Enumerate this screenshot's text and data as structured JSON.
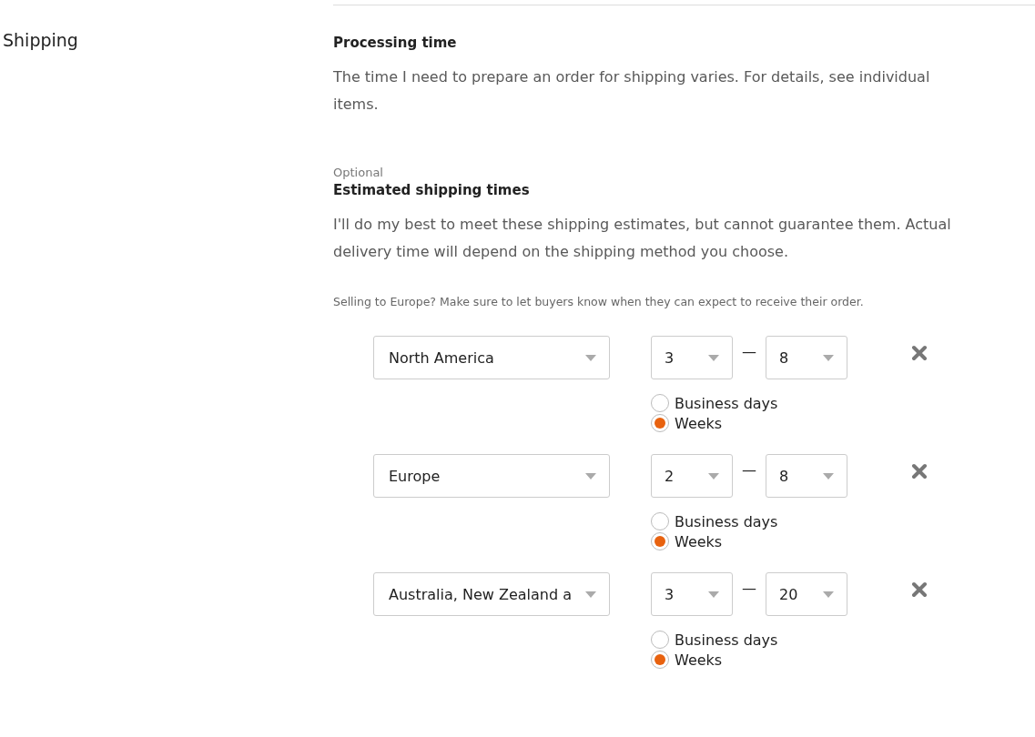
{
  "section_title": "Shipping",
  "processing": {
    "title": "Processing time",
    "text": "The time I need to prepare an order for shipping varies. For details, see individual items."
  },
  "estimates": {
    "optional_label": "Optional",
    "title": "Estimated shipping times",
    "text": "I'll do my best to meet these shipping estimates, but cannot guarantee them. Actual delivery time will depend on the shipping method you choose.",
    "note": "Selling to Europe? Make sure to let buyers know when they can expect to receive their order."
  },
  "rows": [
    {
      "region": "North America",
      "min": "3",
      "separator": "—",
      "max": "8",
      "units": [
        {
          "label": "Business days",
          "selected": false
        },
        {
          "label": "Weeks",
          "selected": true
        }
      ]
    },
    {
      "region": "Europe",
      "min": "2",
      "separator": "—",
      "max": "8",
      "units": [
        {
          "label": "Business days",
          "selected": false
        },
        {
          "label": "Weeks",
          "selected": true
        }
      ]
    },
    {
      "region": "Australia, New Zealand a",
      "min": "3",
      "separator": "—",
      "max": "20",
      "units": [
        {
          "label": "Business days",
          "selected": false
        },
        {
          "label": "Weeks",
          "selected": true
        }
      ]
    }
  ]
}
